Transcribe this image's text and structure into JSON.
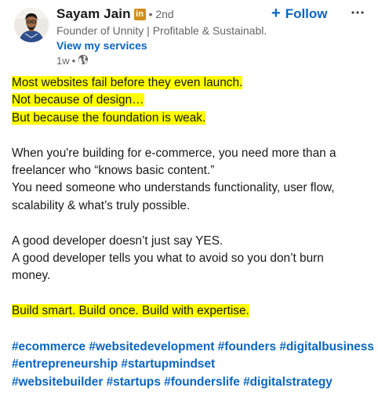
{
  "author": {
    "name": "Sayam Jain",
    "badge": "in",
    "degree": "• 2nd",
    "headline": "Founder of Unnity | Profitable & Sustainabl...",
    "services_link": "View my services",
    "time": "1w",
    "visibility_icon": "globe-icon"
  },
  "actions": {
    "follow_label": "Follow",
    "follow_icon": "plus-icon",
    "more_icon": "more-horizontal-icon"
  },
  "colors": {
    "link_blue": "#0a66c2",
    "highlight": "#ffff00",
    "badge": "#d18e1a",
    "muted_text": "#666666",
    "body_text": "#191919"
  },
  "post": {
    "p1": [
      "Most websites fail before they even launch.",
      "Not because of design…",
      "But because the foundation is weak."
    ],
    "p2": [
      "When you're building for e-commerce, you need more than a",
      "freelancer who “knows basic content.”",
      "You need someone who understands functionality, user flow,",
      "scalability & what’s truly possible."
    ],
    "p3": [
      "A good developer doesn’t just say YES.",
      "A good developer tells you what to avoid so you don’t burn",
      "money."
    ],
    "p4": [
      "Build smart. Build once. Build with expertise."
    ],
    "hashtags": [
      [
        "#ecommerce",
        "#websitedevelopment",
        "#founders",
        "#digitalbusiness"
      ],
      [
        "#entrepreneurship",
        "#startupmindset"
      ],
      [
        "#websitebuilder",
        "#startups",
        "#founderslife",
        "#digitalstrategy"
      ]
    ]
  }
}
